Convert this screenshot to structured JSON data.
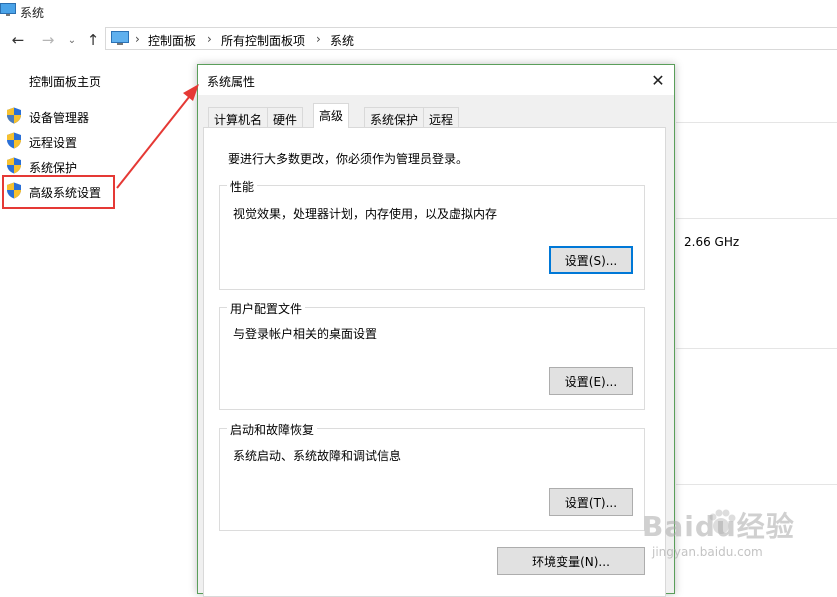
{
  "window": {
    "title": "系统"
  },
  "nav": {
    "breadcrumbs": [
      "控制面板",
      "所有控制面板项",
      "系统"
    ],
    "separator": "›"
  },
  "sidebar": {
    "home": "控制面板主页",
    "items": [
      {
        "label": "设备管理器",
        "icon": "shield-icon"
      },
      {
        "label": "远程设置",
        "icon": "shield-icon"
      },
      {
        "label": "系统保护",
        "icon": "shield-icon"
      },
      {
        "label": "高级系统设置",
        "icon": "shield-icon"
      }
    ]
  },
  "background": {
    "processor_speed": "2.66 GHz"
  },
  "dialog": {
    "title": "系统属性",
    "tabs": [
      "计算机名",
      "硬件",
      "高级",
      "系统保护",
      "远程"
    ],
    "active_tab": "高级",
    "notice": "要进行大多数更改，你必须作为管理员登录。",
    "groups": [
      {
        "title": "性能",
        "description": "视觉效果，处理器计划，内存使用，以及虚拟内存",
        "button": "设置(S)..."
      },
      {
        "title": "用户配置文件",
        "description": "与登录帐户相关的桌面设置",
        "button": "设置(E)..."
      },
      {
        "title": "启动和故障恢复",
        "description": "系统启动、系统故障和调试信息",
        "button": "设置(T)..."
      }
    ],
    "env_button": "环境变量(N)..."
  },
  "colors": {
    "highlight": "#e53935",
    "accent": "#0078d7",
    "shield_blue": "#2a6fd6",
    "shield_yellow": "#f6c02e"
  },
  "watermark": {
    "brand": "Baidu经验",
    "url": "jingyan.baidu.com"
  }
}
